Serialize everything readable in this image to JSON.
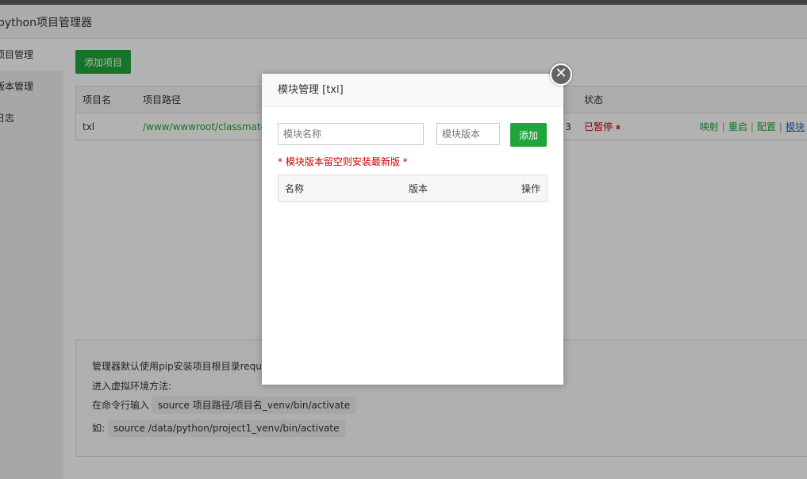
{
  "app": {
    "title": "python项目管理器",
    "sidebar": [
      "项目管理",
      "版本管理",
      "日志"
    ],
    "add_project_label": "添加项目",
    "table": {
      "headers": [
        "项目名",
        "项目路径",
        "",
        "状态",
        ""
      ],
      "row": {
        "name": "txl",
        "path": "/www/wwwroot/classmate",
        "hidden_fragment": "3",
        "status": "已暂停",
        "status_icon": "⏸",
        "ops": [
          "映射",
          "重启",
          "配置",
          "模块"
        ]
      }
    },
    "tips": {
      "line1": "管理器默认使用pip安装项目根目录requ",
      "line2": "进入虚拟环境方法:",
      "line3_prefix": "在命令行输入",
      "line3_code": "source 项目路径/项目名_venv/bin/activate",
      "line4_prefix": "如:",
      "line4_code": "source /data/python/project1_venv/bin/activate"
    }
  },
  "modal": {
    "title": "模块管理 [txl]",
    "close_icon": "✕",
    "name_placeholder": "模块名称",
    "version_placeholder": "模块版本",
    "add_label": "添加",
    "hint": "* 模块版本留空则安装最新版 *",
    "columns": [
      "名称",
      "版本",
      "操作"
    ]
  },
  "colors": {
    "accent": "#20a53a",
    "danger": "#cc0000",
    "link": "#1e6cb8"
  }
}
